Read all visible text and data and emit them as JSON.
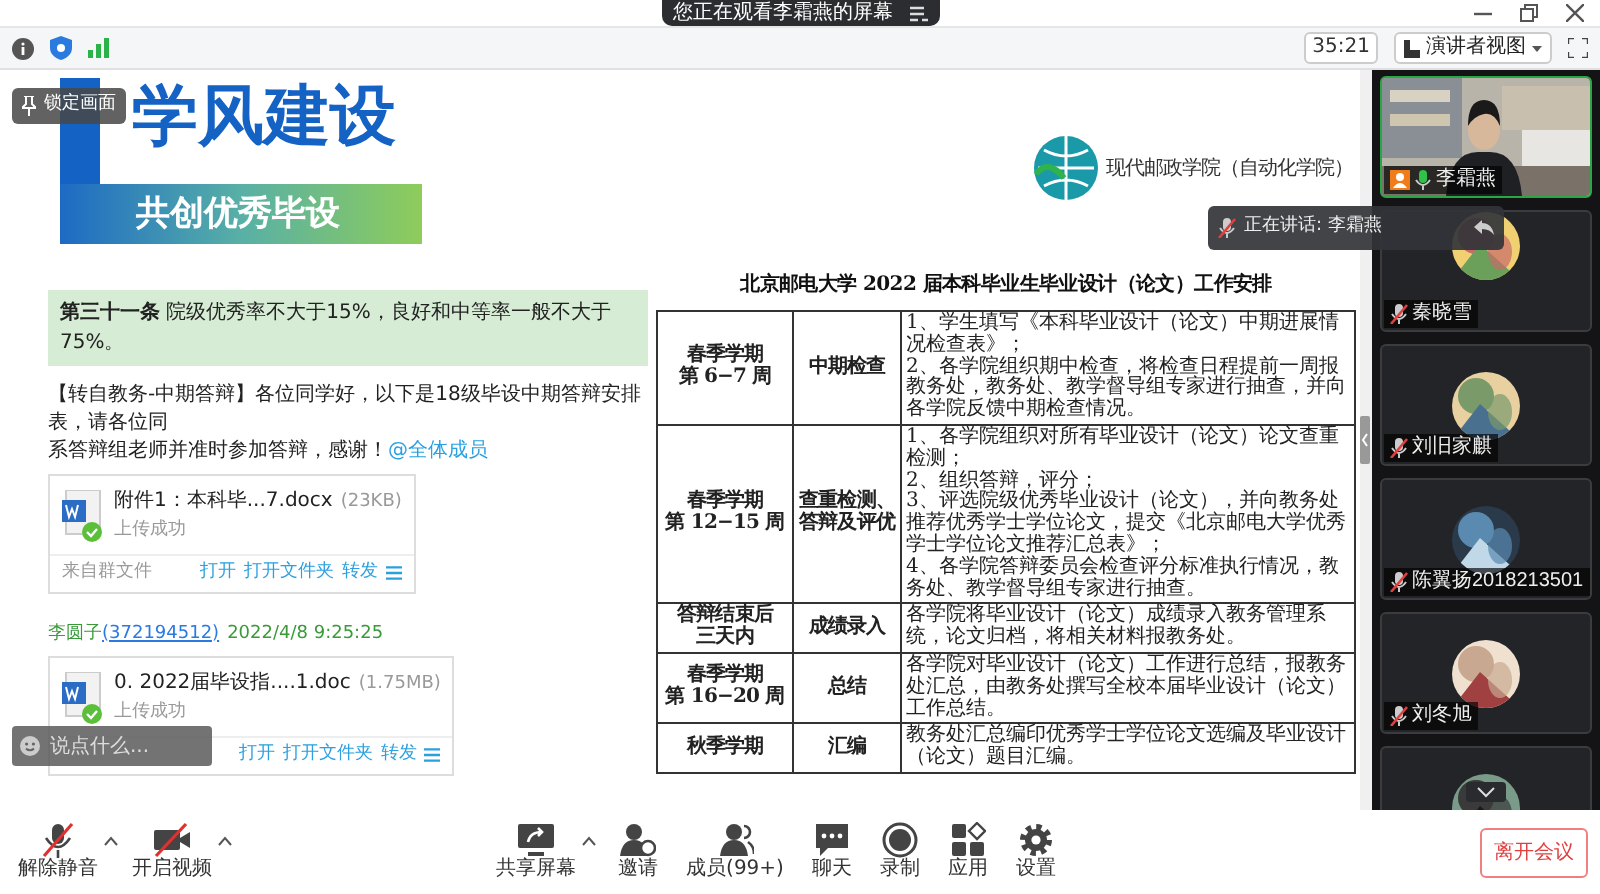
{
  "banner": {
    "text": "您正在观看李霜燕的屏幕"
  },
  "top_bar": {
    "timer": "35:21",
    "view_button": "演讲者视图"
  },
  "shared_screen": {
    "lock_button": "锁定画面",
    "title": "学风建设",
    "subtitle": "共创优秀毕设",
    "logo_text": "现代邮政学院（自动化学院）",
    "rule": {
      "label": "第三十一条",
      "text": "院级优秀率不大于15%，良好和中等率一般不大于75%。"
    },
    "message": {
      "lines": [
        "【转自教务-中期答辩】各位同学好，以下是18级毕设中期答辩安排表，请各位同",
        "系答辩组老师并准时参加答辩，感谢！"
      ],
      "mention": "@全体成员"
    },
    "files": [
      {
        "name": "附件1：本科毕...7.docx",
        "size": "(23KB)",
        "status": "上传成功",
        "source": "来自群文件",
        "actions": [
          "打开",
          "打开文件夹",
          "转发"
        ]
      },
      {
        "sender": {
          "name": "李圆子",
          "id": "(372194512)",
          "time": "2022/4/8 9:25:25"
        },
        "name": "0. 2022届毕设指....1.doc",
        "size": "(1.75MB)",
        "status": "上传成功",
        "actions": [
          "打开",
          "打开文件夹",
          "转发"
        ]
      }
    ],
    "table": {
      "title": "北京邮电大学 2022 届本科毕业生毕业设计（论文）工作安排",
      "rows": [
        {
          "period": [
            "春季学期",
            "第 6−7 周"
          ],
          "stage": [
            "中期检查"
          ],
          "details": [
            "1、学生填写《本科毕业设计（论文）中期进展情况检查表》；",
            "2、各学院组织期中检查，将检查日程提前一周报教务处，教务处、教学督导组专家进行抽查，并向各学院反馈中期检查情况。"
          ]
        },
        {
          "period": [
            "春季学期",
            "第 12−15 周"
          ],
          "stage": [
            "查重检测、",
            "答辩及评优"
          ],
          "details": [
            "1、各学院组织对所有毕业设计（论文）论文查重检测；",
            "2、组织答辩，评分；",
            "3、评选院级优秀毕业设计（论文），并向教务处推荐优秀学士学位论文，提交《北京邮电大学优秀学士学位论文推荐汇总表》；",
            "4、各学院答辩委员会检查评分标准执行情况，教务处、教学督导组专家进行抽查。"
          ]
        },
        {
          "period": [
            "答辩结束后",
            "三天内"
          ],
          "stage": [
            "成绩录入"
          ],
          "details": [
            "各学院将毕业设计（论文）成绩录入教务管理系统，论文归档，将相关材料报教务处。"
          ]
        },
        {
          "period": [
            "春季学期",
            "第 16−20 周"
          ],
          "stage": [
            "总结"
          ],
          "details": [
            "各学院对毕业设计（论文）工作进行总结，报教务处汇总，由教务处撰写全校本届毕业设计（论文）工作总结。"
          ]
        },
        {
          "period": [
            "秋季学期"
          ],
          "stage": [
            "汇编"
          ],
          "details": [
            "教务处汇总编印优秀学士学位论文选编及毕业设计（论文）题目汇编。"
          ]
        }
      ]
    }
  },
  "chat_input": {
    "placeholder": "说点什么..."
  },
  "speaking": {
    "label": "正在讲话: 李霜燕"
  },
  "participants": [
    {
      "kind": "video",
      "name": "李霜燕",
      "host": true,
      "muted": false
    },
    {
      "kind": "avatar",
      "name": "秦晓雪",
      "host": false,
      "muted": true
    },
    {
      "kind": "avatar",
      "name": "刘旧家麒",
      "host": false,
      "muted": true
    },
    {
      "kind": "avatar",
      "name": "陈翼扬2018213501",
      "host": false,
      "muted": true
    },
    {
      "kind": "avatar",
      "name": "刘冬旭",
      "host": false,
      "muted": true
    },
    {
      "kind": "avatar",
      "host": false
    }
  ],
  "toolbar": {
    "left": [
      {
        "kind": "mic",
        "label": "解除静音",
        "off": true,
        "has_menu": true
      },
      {
        "kind": "camera",
        "label": "开启视频",
        "off": true,
        "has_menu": true
      }
    ],
    "center": [
      {
        "kind": "share",
        "label": "共享屏幕",
        "has_menu": true
      },
      {
        "kind": "invite",
        "label": "邀请",
        "has_menu": false
      },
      {
        "kind": "members",
        "label": "成员(99+)",
        "has_menu": false
      },
      {
        "kind": "chat",
        "label": "聊天",
        "has_menu": false
      },
      {
        "kind": "record",
        "label": "录制",
        "has_menu": false
      },
      {
        "kind": "apps",
        "label": "应用",
        "has_menu": false
      },
      {
        "kind": "settings",
        "label": "设置",
        "has_menu": false
      }
    ]
  },
  "leave_button": "离开会议"
}
